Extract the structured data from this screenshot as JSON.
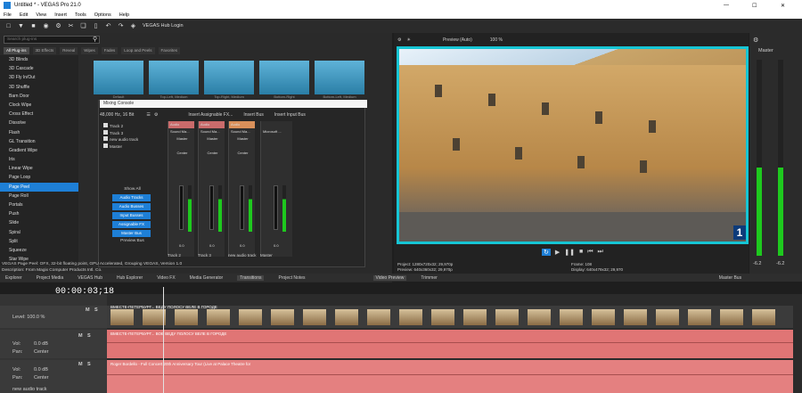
{
  "window": {
    "title": "Untitled * - VEGAS Pro 21.0"
  },
  "menu": [
    "File",
    "Edit",
    "View",
    "Insert",
    "Tools",
    "Options",
    "Help"
  ],
  "toolbar": {
    "hub_login": "VEGAS Hub Login"
  },
  "search": {
    "placeholder": "Search plug-ins"
  },
  "fx_tabs": [
    "All Plug-ins",
    "3D Effects",
    "Reveal",
    "Wipes",
    "Fades",
    "Loop and Peels",
    "Favorites"
  ],
  "plugins": [
    "3D Blinds",
    "3D Cascade",
    "3D Fly In/Out",
    "3D Shuffle",
    "Barn Door",
    "Clock Wipe",
    "Cross Effect",
    "Dissolve",
    "Flash",
    "GL Transition",
    "Gradient Wipe",
    "Iris",
    "Linear Wipe",
    "Page Loop",
    "Page Peel",
    "Page Roll",
    "Portals",
    "Push",
    "Slide",
    "Spiral",
    "Split",
    "Squeeze",
    "Star Wipe"
  ],
  "thumbs": [
    "Default",
    "Top-Left, Medium",
    "Top-Right, Medium",
    "Bottom-Right",
    "Bottom-Left, Medium"
  ],
  "mixer": {
    "title": "Mixing Console",
    "format": "48,000 Hz, 16 Bit",
    "insert_fx": "Insert Assignable FX...",
    "insert_bus": "Insert Bus",
    "insert_input": "Insert Input Bus",
    "tracks": [
      "Track 2",
      "Track 3",
      "new audio track",
      "Master"
    ],
    "show_all": "Show All",
    "buttons": [
      "Audio Tracks",
      "Audio Busses",
      "Input Busses",
      "Assignable FX",
      "Master Bus"
    ],
    "preview_bus": "Preview Bus",
    "strips": [
      {
        "name": "Audio",
        "dest": "Sound Ma...",
        "out": "Master",
        "pan": "Center",
        "val": "0.0",
        "label": "Track 2"
      },
      {
        "name": "Audio",
        "dest": "Sound Ma...",
        "out": "Master",
        "pan": "Center",
        "val": "0.0",
        "label": "Track 3"
      },
      {
        "name": "Audio",
        "dest": "Sound Ma...",
        "out": "Master",
        "pan": "Center",
        "val": "0.0",
        "label": "new audio track"
      },
      {
        "name": "",
        "dest": "Microsoft ...",
        "out": "",
        "pan": "",
        "val": "0.0",
        "label": "Master"
      }
    ]
  },
  "status_text": "VEGAS Page Peel: OFX, 32-bit floating point, GPU Accelerated, Grouping VEGAS, Version 1.0\nDescription: From Magix Computer Products Intl. Co.",
  "preview": {
    "mode": "Preview (Auto)",
    "zoom": "100 %",
    "project": "Project:  1280x720x32; 29,970p",
    "preview_res": "Preview:  640x360x32; 29,970p",
    "video_preview": "Video Preview",
    "frame": "Frame:   108",
    "display": "Display:  640x479x32; 29,970",
    "trimmer": "Trimmer",
    "badge": "1"
  },
  "master": {
    "label": "Master",
    "val1": "-6.2",
    "val2": "-6.2"
  },
  "tabs": [
    "Explorer",
    "Project Media",
    "VEGAS Hub",
    "Hub Explorer",
    "Video FX",
    "Media Generator",
    "Transitions",
    "Project Notes",
    "Master Bus"
  ],
  "timeline": {
    "timecode": "00:00:03;18",
    "level": "Level: 100.0 %",
    "vol": "Vol:",
    "vol_val": "0.0 dB",
    "pan": "Pan:",
    "pan_val": "Center",
    "clip_video": "ВМЕСТЕ-ПЕТЕРБУРГ... ВЕДУ ПОЛОСУ ВЕЛЕ В ГОРОДЕ",
    "clip_audio1": "ВМЕСТЕ-ПЕТЕРБУРГ... ВОВ ВЕДУ ПОЛОСУ ВЕЛЕ В ГОРОДЕ",
    "clip_audio2": "Roger Bordello - Full Concert 20th Anniversary Tour (Live at Palace Theatre for",
    "new_track": "new audio track"
  }
}
